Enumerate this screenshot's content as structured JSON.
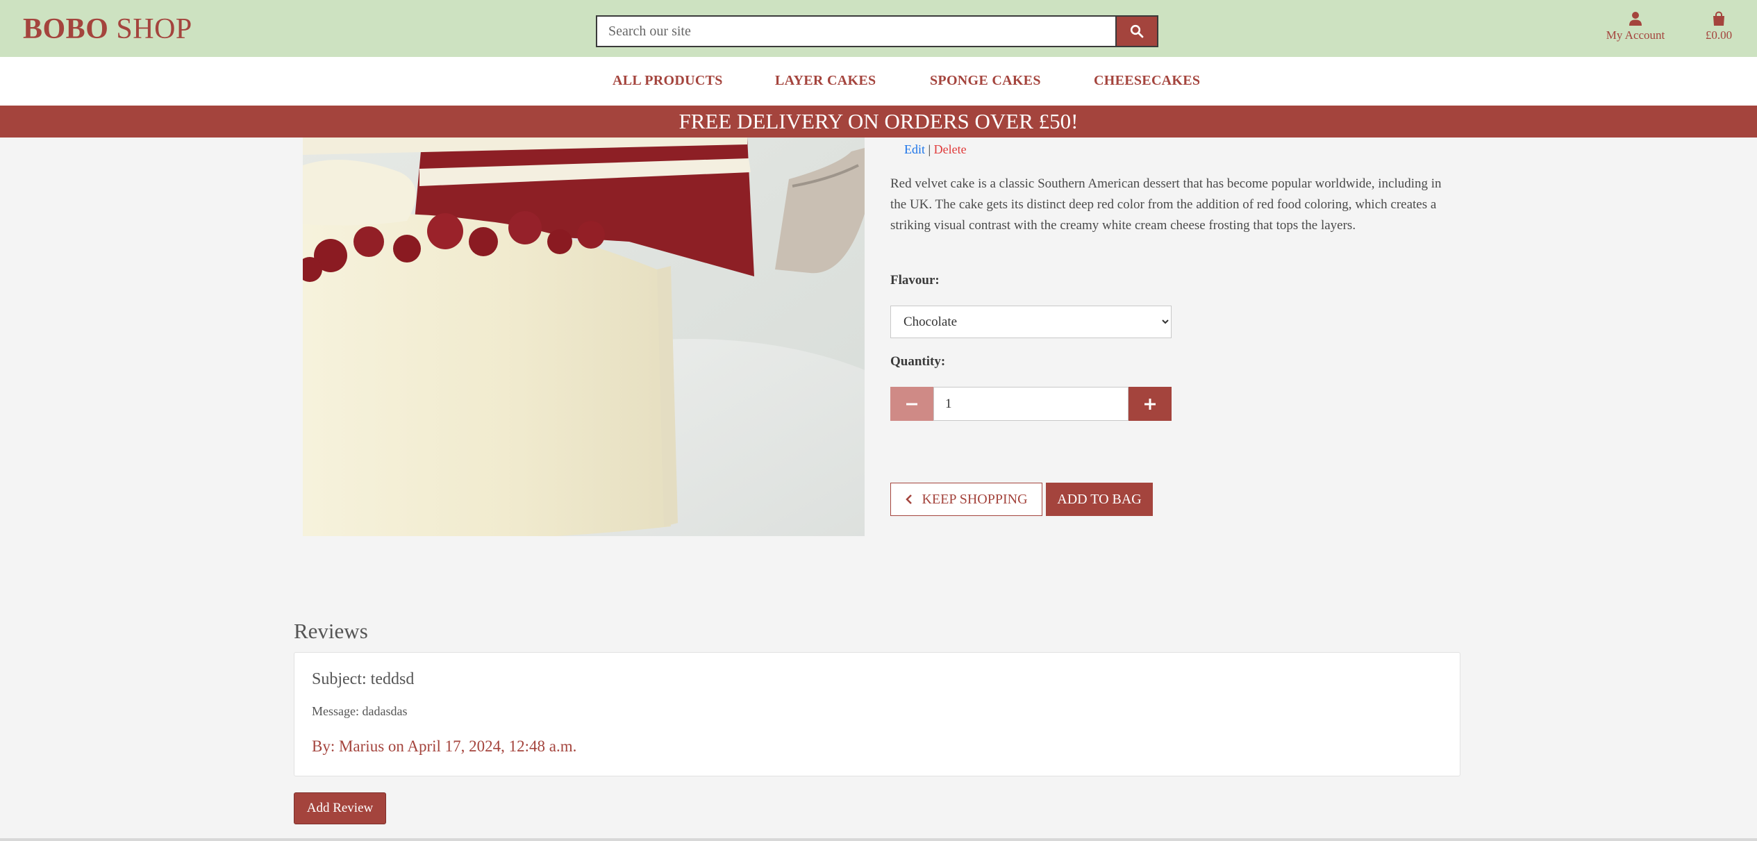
{
  "header": {
    "logo_bold": "BOBO",
    "logo_rest": " SHOP",
    "search_placeholder": "Search our site",
    "account_label": "My Account",
    "bag_total": "£0.00"
  },
  "nav": {
    "items": [
      "ALL PRODUCTS",
      "LAYER CAKES",
      "SPONGE CAKES",
      "CHEESECAKES"
    ]
  },
  "banner": {
    "text": "FREE DELIVERY ON ORDERS OVER £50!"
  },
  "product": {
    "edit_label": "Edit",
    "separator": "|",
    "delete_label": "Delete",
    "description": "Red velvet cake is a classic Southern American dessert that has become popular worldwide, including in the UK. The cake gets its distinct deep red color from the addition of red food coloring, which creates a striking visual contrast with the creamy white cream cheese frosting that tops the layers.",
    "flavour_label": "Flavour:",
    "flavour_selected": "Chocolate",
    "quantity_label": "Quantity:",
    "quantity_value": "1",
    "keep_shopping_label": "KEEP SHOPPING",
    "add_to_bag_label": "ADD TO BAG"
  },
  "reviews": {
    "title": "Reviews",
    "items": [
      {
        "subject": "Subject: teddsd",
        "message": "Message: dadasdas",
        "by": "By: Marius on April 17, 2024, 12:48 a.m."
      }
    ],
    "add_label": "Add Review"
  },
  "colors": {
    "brand": "#a4443d",
    "header_bg": "#cde2c1",
    "page_bg": "#f4f4f4",
    "link_blue": "#1a73e8",
    "delete_red": "#e03a3a"
  }
}
